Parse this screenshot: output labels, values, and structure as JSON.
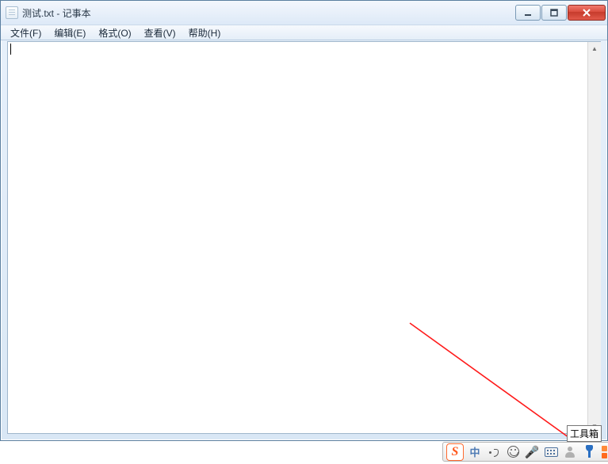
{
  "window": {
    "title": "测试.txt - 记事本"
  },
  "menu": {
    "file": "文件(F)",
    "edit": "编辑(E)",
    "format": "格式(O)",
    "view": "查看(V)",
    "help": "帮助(H)"
  },
  "editor": {
    "content": ""
  },
  "tooltip": {
    "text": "工具箱"
  },
  "ime": {
    "mode": "中"
  }
}
